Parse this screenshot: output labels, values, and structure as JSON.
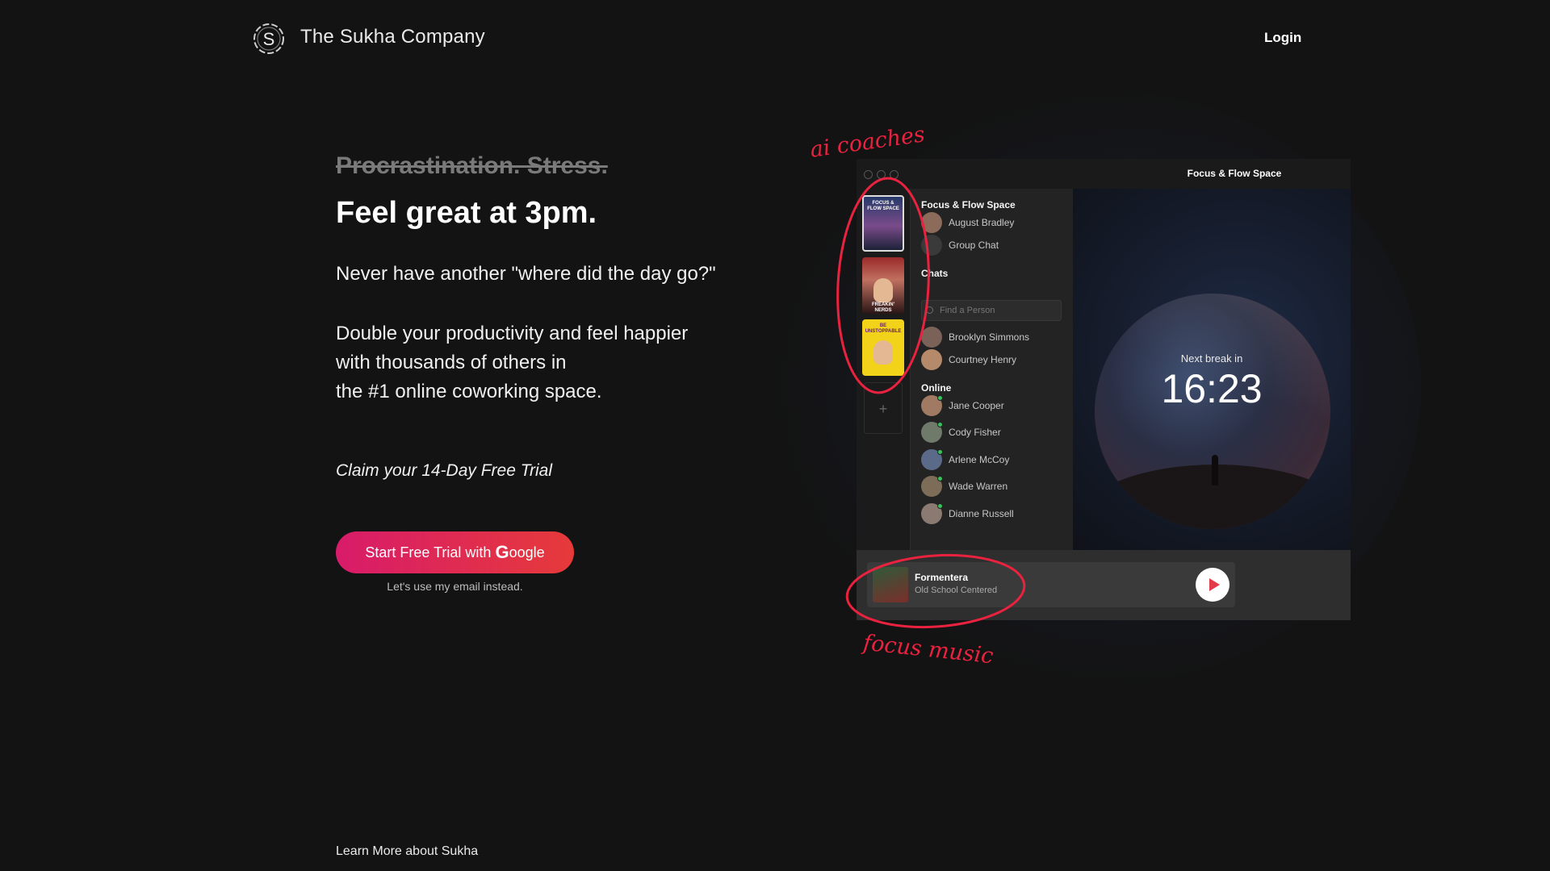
{
  "header": {
    "brand": "The Sukha Company",
    "logo_letter": "S",
    "login_label": "Login"
  },
  "hero": {
    "strikethrough": "Procrastination. Stress.",
    "headline": "Feel great at 3pm.",
    "subheading": "Never have another \"where did the day go?\"",
    "body_lines": [
      "Double your productivity and feel happier",
      "with thousands of others in",
      "the #1 online coworking space."
    ],
    "claim": "Claim your 14-Day Free Trial",
    "cta_prefix": "Start Free Trial with ",
    "cta_g": "G",
    "cta_suffix": "oogle",
    "email_link": "Let's use my email instead.",
    "learn_more": "Learn More about Sukha"
  },
  "mockup": {
    "window_title": "Focus & Flow Space",
    "rail": {
      "thumb1_label": "FOCUS & FLOW SPACE",
      "thumb2_label": "FREAKIN' NERDS",
      "thumb3_label": "BE UNSTOPPABLE",
      "add_symbol": "+"
    },
    "space_section": "Focus & Flow Space",
    "space_items": [
      "August Bradley",
      "Group Chat"
    ],
    "chats_section": "Chats",
    "search_placeholder": "Find a Person",
    "chats": [
      "Brooklyn Simmons",
      "Courtney Henry"
    ],
    "online_section": "Online",
    "online": [
      "Jane Cooper",
      "Cody Fisher",
      "Arlene McCoy",
      "Wade Warren",
      "Dianne Russell"
    ],
    "break_label": "Next break in",
    "break_time": "16:23",
    "player": {
      "track": "Formentera",
      "artist": "Old School Centered"
    }
  },
  "annotations": {
    "coaches": "ai coaches",
    "music": "focus music"
  },
  "colors": {
    "background": "#131313",
    "cta_start": "#d81b6a",
    "cta_end": "#e63a3a",
    "annotation_red": "#e8223f",
    "online_green": "#38c15b"
  }
}
